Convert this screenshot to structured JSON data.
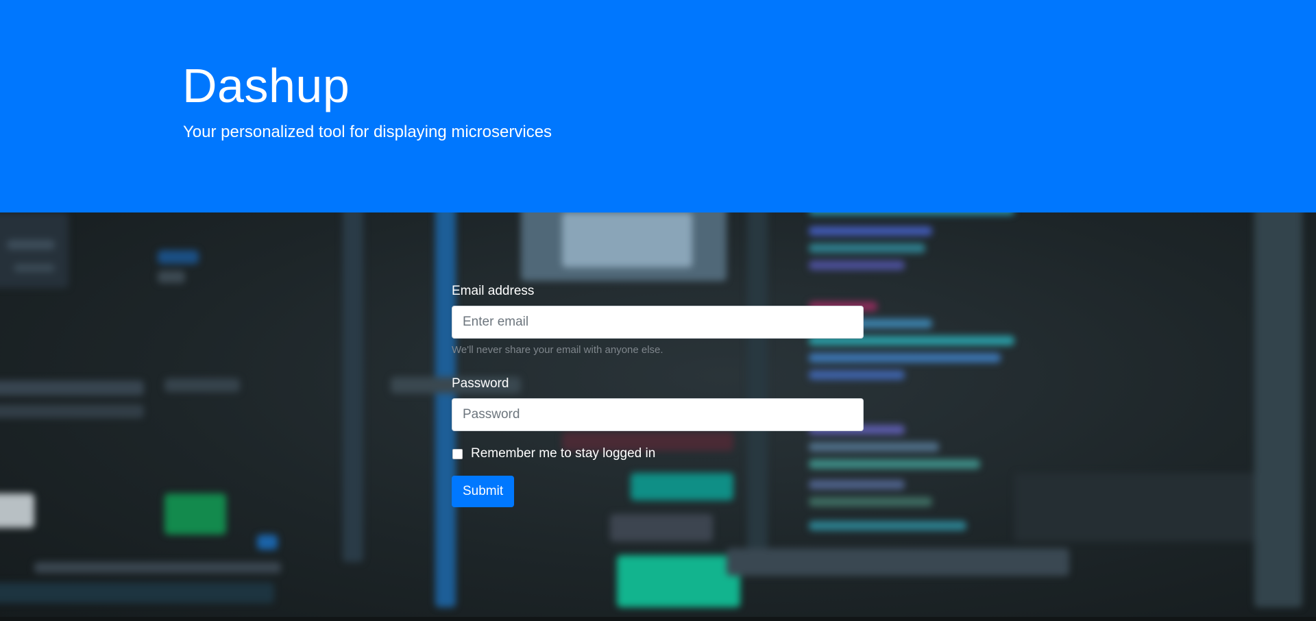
{
  "hero": {
    "title": "Dashup",
    "subtitle": "Your personalized tool for displaying microservices"
  },
  "form": {
    "email": {
      "label": "Email address",
      "placeholder": "Enter email",
      "help": "We'll never share your email with anyone else."
    },
    "password": {
      "label": "Password",
      "placeholder": "Password"
    },
    "remember": {
      "label": "Remember me to stay logged in",
      "checked": false
    },
    "submit_label": "Submit"
  },
  "colors": {
    "hero_background": "#0077fe",
    "button_background": "#0078ff",
    "page_background": "#1b2226"
  },
  "background_image": "blurred-code-on-monitor"
}
